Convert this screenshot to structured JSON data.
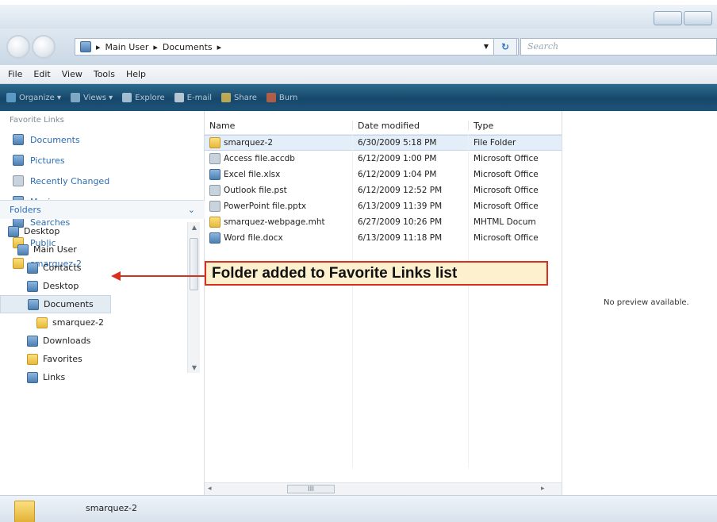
{
  "window": {
    "buttons": [
      "minimize",
      "maximize"
    ]
  },
  "address": {
    "crumbs": [
      "Main User",
      "Documents"
    ],
    "separator": "▸",
    "search_placeholder": "Search"
  },
  "menu": [
    "File",
    "Edit",
    "View",
    "Tools",
    "Help"
  ],
  "toolbar": [
    {
      "label": "Organize ▾",
      "icon": "organize-icon",
      "color": "#6fb3e0"
    },
    {
      "label": "Views ▾",
      "icon": "views-icon",
      "color": "#9fc7e0"
    },
    {
      "label": "Explore",
      "icon": "explore-icon",
      "color": "#cfe3f2"
    },
    {
      "label": "E-mail",
      "icon": "email-icon",
      "color": "#e8eef3"
    },
    {
      "label": "Share",
      "icon": "share-icon",
      "color": "#f2c84b"
    },
    {
      "label": "Burn",
      "icon": "burn-icon",
      "color": "#e0643a"
    }
  ],
  "favorites": {
    "title": "Favorite Links",
    "items": [
      {
        "label": "Documents",
        "icon": "doc"
      },
      {
        "label": "Pictures",
        "icon": "doc"
      },
      {
        "label": "Recently Changed",
        "icon": "gen"
      },
      {
        "label": "Music",
        "icon": "doc"
      },
      {
        "label": "Searches",
        "icon": "doc"
      },
      {
        "label": "Public",
        "icon": "folder"
      },
      {
        "label": "smarquez-2",
        "icon": "folder"
      }
    ]
  },
  "folders": {
    "title": "Folders",
    "tree": [
      {
        "label": "Desktop",
        "indent": 0,
        "icon": "doc"
      },
      {
        "label": "Main User",
        "indent": 1,
        "icon": "doc"
      },
      {
        "label": "Contacts",
        "indent": 2,
        "icon": "doc"
      },
      {
        "label": "Desktop",
        "indent": 2,
        "icon": "doc"
      },
      {
        "label": "Documents",
        "indent": 2,
        "icon": "doc",
        "selected": true
      },
      {
        "label": "smarquez-2",
        "indent": 3,
        "icon": "folder"
      },
      {
        "label": "Downloads",
        "indent": 2,
        "icon": "doc"
      },
      {
        "label": "Favorites",
        "indent": 2,
        "icon": "folder"
      },
      {
        "label": "Links",
        "indent": 2,
        "icon": "doc"
      }
    ]
  },
  "files": {
    "columns": [
      "Name",
      "Date modified",
      "Type"
    ],
    "rows": [
      {
        "name": "smarquez-2",
        "date": "6/30/2009 5:18 PM",
        "type": "File Folder",
        "icon": "folder",
        "selected": true
      },
      {
        "name": "Access file.accdb",
        "date": "6/12/2009 1:00 PM",
        "type": "Microsoft Office",
        "icon": "gen"
      },
      {
        "name": "Excel file.xlsx",
        "date": "6/12/2009 1:04 PM",
        "type": "Microsoft Office",
        "icon": "doc"
      },
      {
        "name": "Outlook file.pst",
        "date": "6/12/2009 12:52 PM",
        "type": "Microsoft Office",
        "icon": "gen"
      },
      {
        "name": "PowerPoint file.pptx",
        "date": "6/13/2009 11:39 PM",
        "type": "Microsoft Office",
        "icon": "gen"
      },
      {
        "name": "smarquez-webpage.mht",
        "date": "6/27/2009 10:26 PM",
        "type": "MHTML Docum",
        "icon": "folder"
      },
      {
        "name": "Word file.docx",
        "date": "6/13/2009 11:18 PM",
        "type": "Microsoft Office",
        "icon": "doc"
      }
    ]
  },
  "preview": {
    "text": "No preview available."
  },
  "status": {
    "label": "smarquez-2"
  },
  "callout": {
    "text": "Folder added to Favorite Links list",
    "border_color": "#d6311f",
    "fill_color": "#fcf0cf"
  },
  "scroll": {
    "hscroll_thumb": "III"
  }
}
